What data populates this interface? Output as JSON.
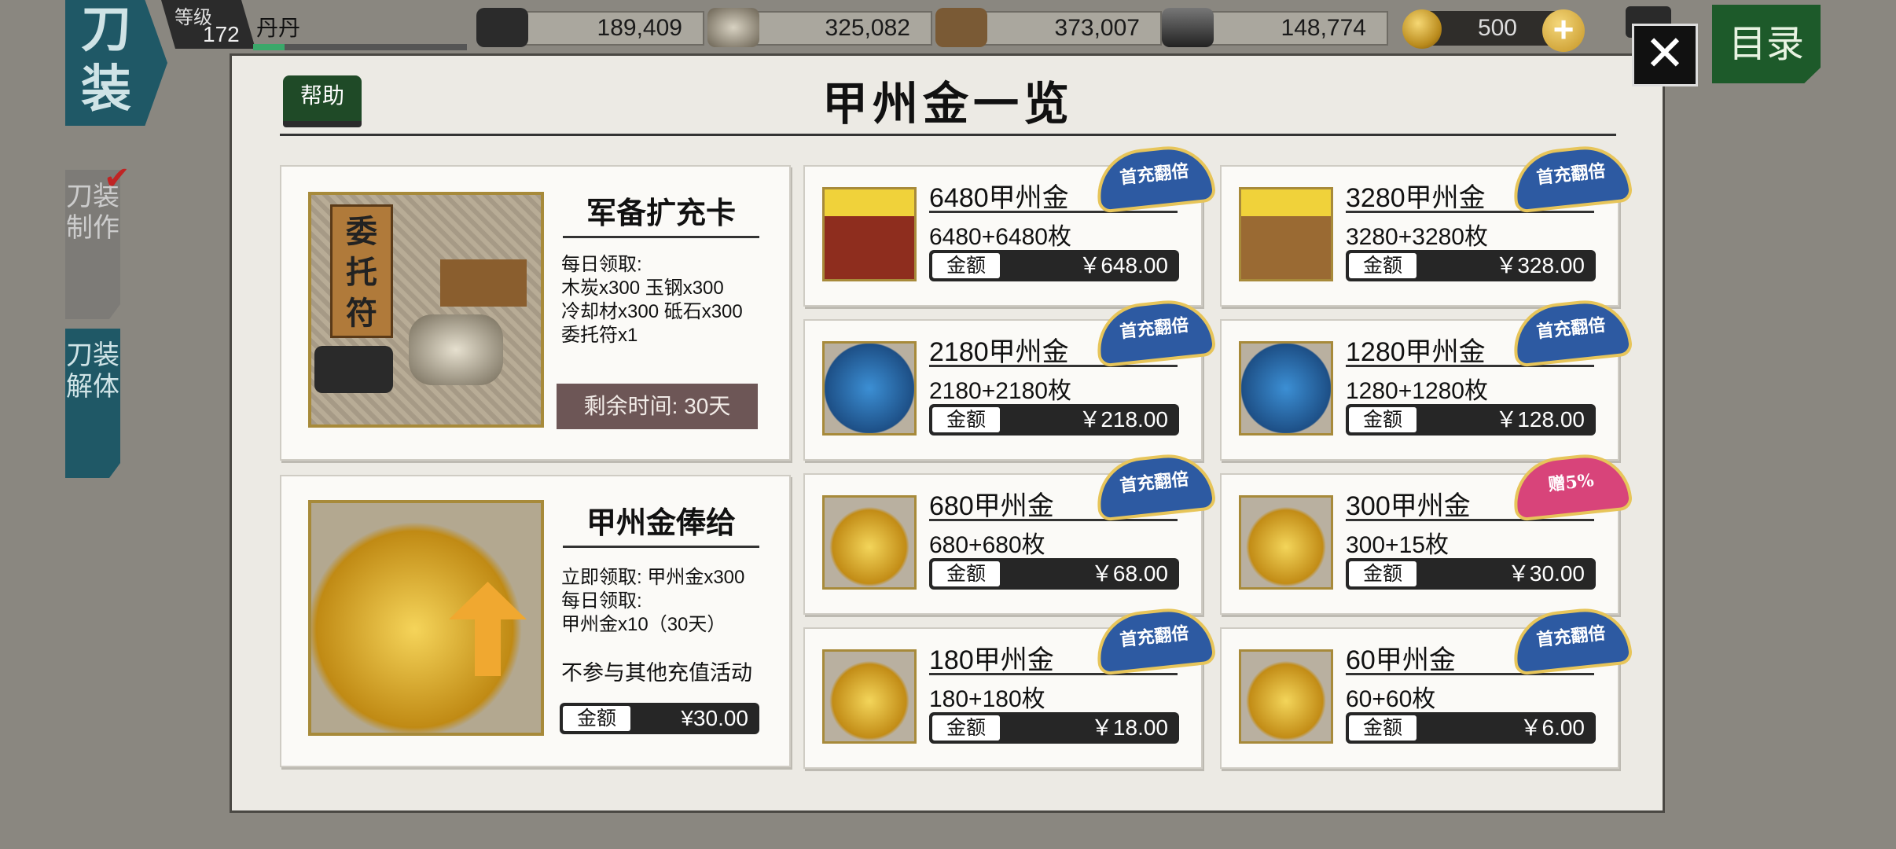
{
  "header": {
    "logo_text": "刀装",
    "level_label": "等级",
    "level_value": "172",
    "player_name": "丹丹",
    "resources": [
      {
        "icon": "charcoal-icon",
        "value": "189,409"
      },
      {
        "icon": "whetstone-icon",
        "value": "325,082"
      },
      {
        "icon": "coolant-icon",
        "value": "373,007"
      },
      {
        "icon": "steel-icon",
        "value": "148,774"
      }
    ],
    "gold_value": "500",
    "add_label": "+",
    "menu_label": "目录"
  },
  "sidebar": {
    "tabs": [
      {
        "label": "刀装制作"
      },
      {
        "label": "刀装解体"
      }
    ]
  },
  "panel": {
    "help_label": "帮助",
    "title": "甲州金一览",
    "close_label": "✕",
    "military_card": {
      "image_text": "委托符",
      "title": "军备扩充卡",
      "desc": [
        "每日领取:",
        "木炭x300 玉钢x300",
        "冷却材x300 砥石x300",
        "委托符x1"
      ],
      "time_label": "剩余时间: 30天"
    },
    "salary_card": {
      "title": "甲州金俸给",
      "desc": [
        "立即领取: 甲州金x300",
        "每日领取:",
        "甲州金x10（30天）"
      ],
      "note": "不参与其他充值活动",
      "price_label": "金额",
      "price": "¥30.00"
    },
    "packs": [
      {
        "name": "6480甲州金",
        "sub": "6480+6480枚",
        "price_label": "金额",
        "price": "￥648.00",
        "badge": "首充翻倍",
        "art": "chest"
      },
      {
        "name": "3280甲州金",
        "sub": "3280+3280枚",
        "price_label": "金额",
        "price": "￥328.00",
        "badge": "首充翻倍",
        "art": "chest2"
      },
      {
        "name": "2180甲州金",
        "sub": "2180+2180枚",
        "price_label": "金额",
        "price": "￥218.00",
        "badge": "首充翻倍",
        "art": "bag"
      },
      {
        "name": "1280甲州金",
        "sub": "1280+1280枚",
        "price_label": "金额",
        "price": "￥128.00",
        "badge": "首充翻倍",
        "art": "bag"
      },
      {
        "name": "680甲州金",
        "sub": "680+680枚",
        "price_label": "金额",
        "price": "￥68.00",
        "badge": "首充翻倍",
        "art": "coins"
      },
      {
        "name": "300甲州金",
        "sub": "300+15枚",
        "price_label": "金额",
        "price": "￥30.00",
        "badge": "赠5%",
        "art": "coins"
      },
      {
        "name": "180甲州金",
        "sub": "180+180枚",
        "price_label": "金额",
        "price": "￥18.00",
        "badge": "首充翻倍",
        "art": "coins"
      },
      {
        "name": "60甲州金",
        "sub": "60+60枚",
        "price_label": "金额",
        "price": "￥6.00",
        "badge": "首充翻倍",
        "art": "coins"
      }
    ]
  },
  "colors": {
    "accent_green": "#1d5a2a",
    "teal": "#1f5866",
    "badge_blue": "#2d5aa2",
    "badge_pink": "#d8447a"
  }
}
